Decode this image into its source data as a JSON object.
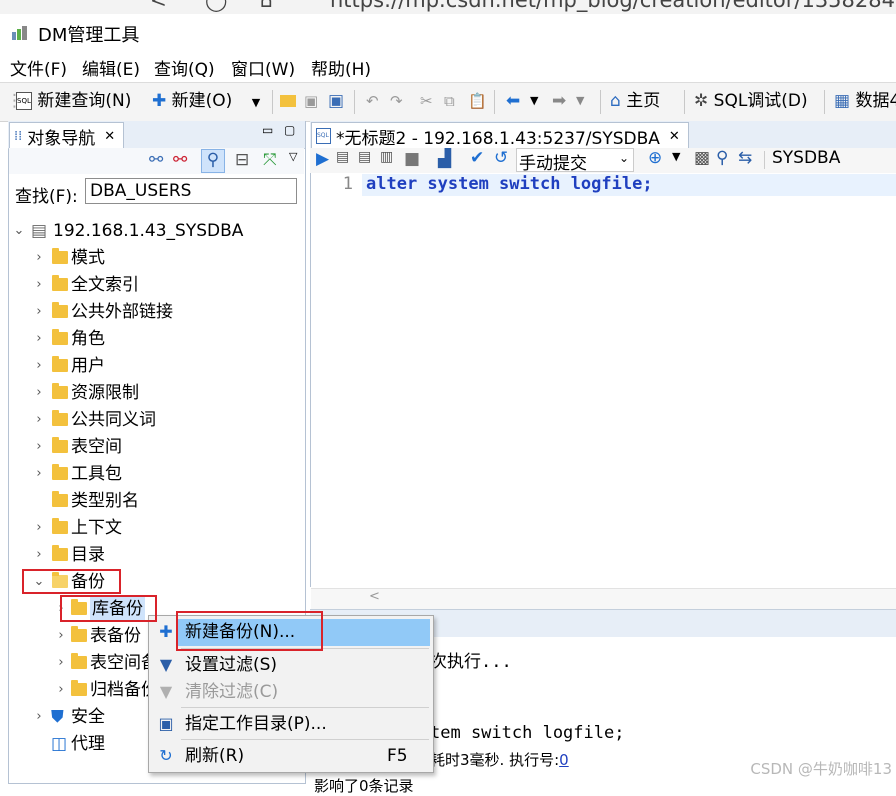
{
  "browser": {
    "url": "https://mp.csdn.net/mp_blog/creation/editor/1358284"
  },
  "window": {
    "title": "DM管理工具"
  },
  "menubar": [
    "文件(F)",
    "编辑(E)",
    "查询(Q)",
    "窗口(W)",
    "帮助(H)"
  ],
  "toolbar": {
    "new_query": "新建查询(N)",
    "new": "新建(O)",
    "home": "主页",
    "sql_debug": "SQL调试(D)",
    "data": "数据4"
  },
  "object_nav": {
    "tab_title": "对象导航",
    "search_label": "查找(F):",
    "search_value": "DBA_USERS",
    "root": "192.168.1.43_SYSDBA",
    "items": [
      {
        "label": "模式"
      },
      {
        "label": "全文索引"
      },
      {
        "label": "公共外部链接"
      },
      {
        "label": "角色"
      },
      {
        "label": "用户"
      },
      {
        "label": "资源限制"
      },
      {
        "label": "公共同义词"
      },
      {
        "label": "表空间"
      },
      {
        "label": "工具包"
      },
      {
        "label": "类型别名"
      },
      {
        "label": "上下文"
      },
      {
        "label": "目录"
      },
      {
        "label": "备份"
      }
    ],
    "backup_children": [
      {
        "label": "库备份"
      },
      {
        "label": "表备份"
      },
      {
        "label": "表空间备份"
      },
      {
        "label": "归档备份"
      }
    ],
    "after_items": [
      {
        "label": "安全"
      },
      {
        "label": "代理"
      }
    ]
  },
  "editor": {
    "tab_title": "*无标题2 - 192.168.1.43:5237/SYSDBA",
    "commit_mode": "手动提交",
    "schema": "SYSDBA",
    "line_no": "1",
    "code": "alter system switch logfile;"
  },
  "console": {
    "line1": "次执行...",
    "line2": "tem switch logfile;",
    "line3_prefix": "耗时3毫秒. 执行号:",
    "line3_link": "0",
    "line4": "影响了0条记录"
  },
  "context_menu": {
    "items": [
      {
        "label": "新建备份(N)...",
        "shortcut": "",
        "enabled": true,
        "icon": "plus-icon"
      },
      {
        "label": "设置过滤(S)",
        "shortcut": "",
        "enabled": true,
        "icon": "filter-icon"
      },
      {
        "label": "清除过滤(C)",
        "shortcut": "",
        "enabled": false,
        "icon": "clear-filter-icon"
      },
      {
        "label": "指定工作目录(P)...",
        "shortcut": "",
        "enabled": true,
        "icon": "folder-icon"
      },
      {
        "label": "刷新(R)",
        "shortcut": "F5",
        "enabled": true,
        "icon": "refresh-icon"
      }
    ]
  },
  "watermark": "CSDN @牛奶咖啡13",
  "colors": {
    "accent": "#1f3fbf",
    "highlight": "#91c9f7",
    "folder": "#f3c13d",
    "annotation": "#d9232a"
  }
}
